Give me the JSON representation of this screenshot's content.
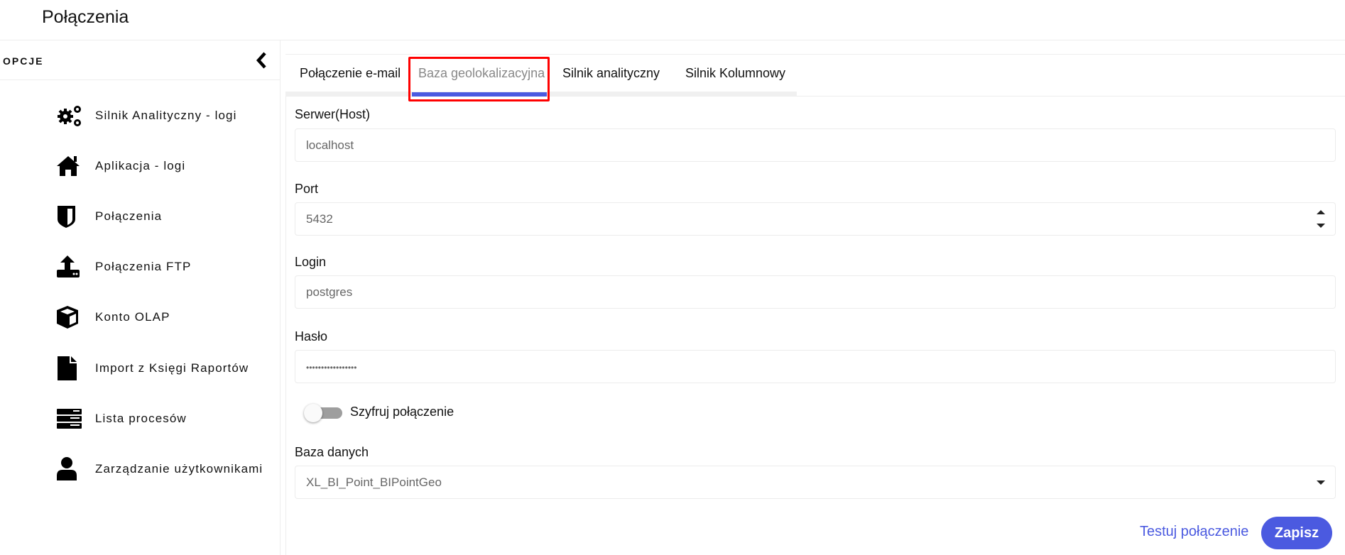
{
  "header": {
    "title": "Połączenia"
  },
  "sidebar": {
    "heading": "OPCJE",
    "items": [
      {
        "label": "Silnik Analityczny - logi",
        "icon": "gears-icon"
      },
      {
        "label": "Aplikacja - logi",
        "icon": "home-icon"
      },
      {
        "label": "Połączenia",
        "icon": "shield-icon"
      },
      {
        "label": "Połączenia FTP",
        "icon": "upload-icon"
      },
      {
        "label": "Konto OLAP",
        "icon": "cube-icon"
      },
      {
        "label": "Import z Księgi Raportów",
        "icon": "file-icon"
      },
      {
        "label": "Lista procesów",
        "icon": "server-icon"
      },
      {
        "label": "Zarządzanie użytkownikami",
        "icon": "user-icon"
      }
    ]
  },
  "tabs": [
    {
      "label": "Połączenie e-mail"
    },
    {
      "label": "Baza geolokalizacyjna",
      "active": true
    },
    {
      "label": "Silnik analityczny"
    },
    {
      "label": "Silnik Kolumnowy"
    }
  ],
  "form": {
    "host": {
      "label": "Serwer(Host)",
      "value": "localhost"
    },
    "port": {
      "label": "Port",
      "value": "5432"
    },
    "login": {
      "label": "Login",
      "value": "postgres"
    },
    "password": {
      "label": "Hasło",
      "value": "•••••••••••••••••"
    },
    "encrypt": {
      "label": "Szyfruj połączenie",
      "on": false
    },
    "database": {
      "label": "Baza danych",
      "value": "XL_BI_Point_BIPointGeo"
    }
  },
  "actions": {
    "test": "Testuj połączenie",
    "save": "Zapisz"
  },
  "colors": {
    "accent": "#4b5ae0",
    "highlight": "#ff0000"
  }
}
